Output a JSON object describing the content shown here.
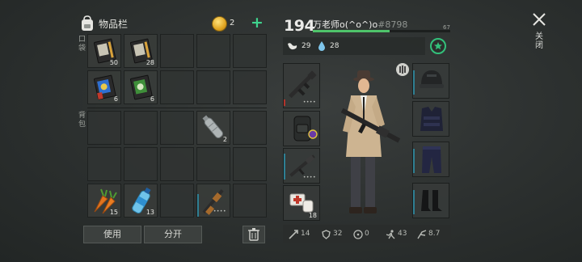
{
  "inventory": {
    "title": "物品栏",
    "coins": "2",
    "pocket_label": "口袋",
    "backpack_label": "背包",
    "pocket_items": [
      {
        "icon": "book-icon",
        "qty": "50"
      },
      {
        "icon": "book-icon",
        "qty": "28"
      },
      {
        "icon": "blue-book-icon",
        "qty": "6"
      },
      {
        "icon": "green-book-icon",
        "qty": "6"
      }
    ],
    "backpack_items": [
      {
        "icon": "plastic-bottle-icon",
        "qty": "2"
      },
      {
        "icon": "carrot-icon",
        "qty": "15"
      },
      {
        "icon": "water-bottle-icon",
        "qty": "13"
      },
      {
        "icon": "shotgun-icon",
        "qty": ""
      }
    ],
    "use_button": "使用",
    "split_button": "分开"
  },
  "player": {
    "level": "194",
    "name": "万老师o(^o^)o",
    "id": "#8798",
    "xp": "67",
    "xp_progress": 0.56,
    "food": "29",
    "water": "28"
  },
  "equipment": {
    "weapon_primary": "assault-rifle-icon",
    "backpack": "backpack-icon",
    "weapon_secondary": "rifle-icon",
    "medkit_qty": "18",
    "helmet": "helmet-icon",
    "vest": "vest-icon",
    "pants": "pants-icon",
    "boots": "boots-icon"
  },
  "stats": {
    "attack": "14",
    "defense": "32",
    "radiation": "0",
    "speed": "43",
    "stamina": "8.7"
  },
  "close_label": "关闭",
  "colors": {
    "accent_green": "#3fd38e",
    "xp_green": "#4ec36a",
    "slot_accent": "#2e7f93",
    "weapon_red": "#b2332b"
  }
}
